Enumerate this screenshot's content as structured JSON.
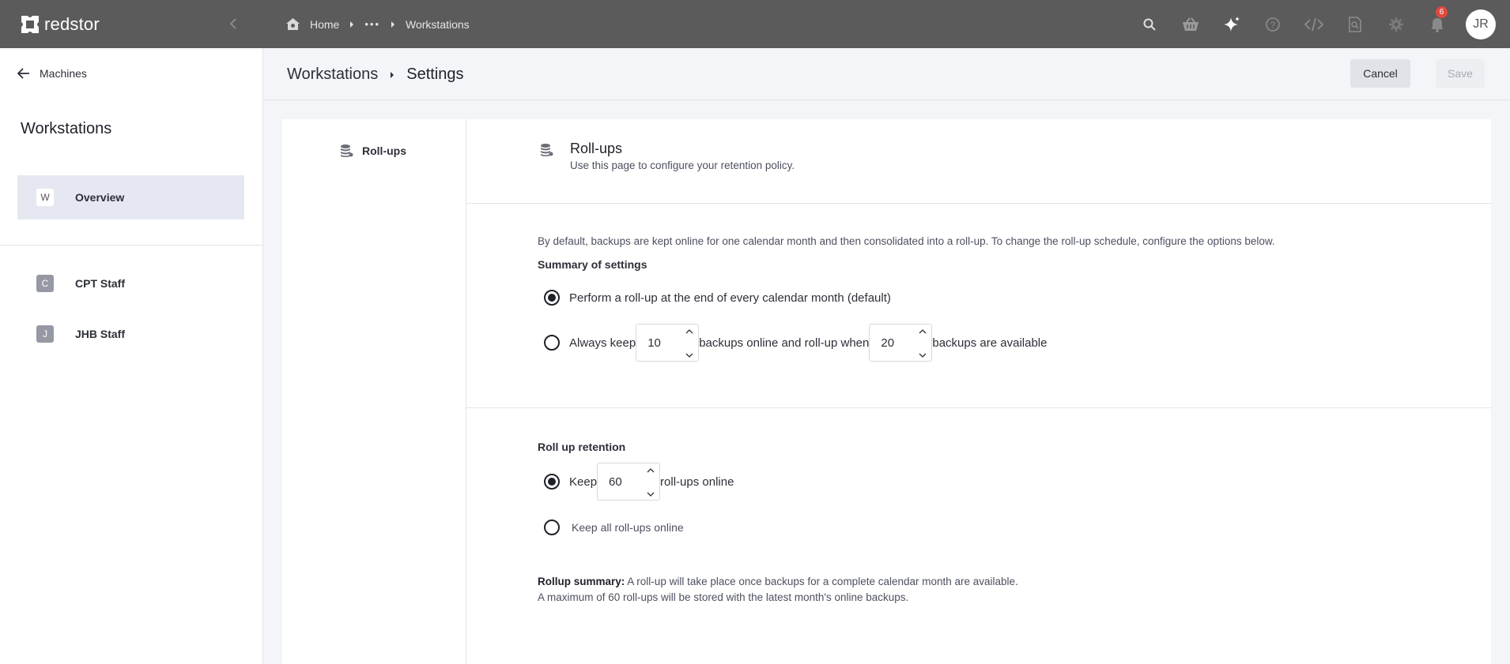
{
  "app": {
    "brand_name": "redstor",
    "accent_color": "#e0493f"
  },
  "topbar": {
    "breadcrumbs": [
      {
        "label": "Home",
        "icon": "home-icon"
      },
      {
        "label": "•••",
        "icon": "ellipsis"
      },
      {
        "label": "Workstations"
      }
    ],
    "icons": [
      "search-icon",
      "basket-icon",
      "sparkle-icon",
      "help-icon",
      "code-icon",
      "file-search-icon",
      "gear-icon",
      "bell-icon"
    ],
    "notification_count": "6",
    "user_initials": "JR"
  },
  "sidebar": {
    "back_label": "Machines",
    "title": "Workstations",
    "items": [
      {
        "letter": "W",
        "label": "Overview",
        "active": true
      },
      {
        "letter": "C",
        "label": "CPT Staff",
        "active": false
      },
      {
        "letter": "J",
        "label": "JHB Staff",
        "active": false
      }
    ]
  },
  "header": {
    "crumb_parent": "Workstations",
    "crumb_current": "Settings",
    "cancel_label": "Cancel",
    "save_label": "Save"
  },
  "settings_nav": {
    "item_label": "Roll-ups"
  },
  "rollups": {
    "title": "Roll-ups",
    "subtitle": "Use this page to configure your retention policy.",
    "description": "By default, backups are kept online for one calendar month and then consolidated into a roll-up. To change the roll-up schedule, configure the options below.",
    "summary_label": "Summary of settings",
    "option_default": "Perform a roll-up at the end of every calendar month (default)",
    "option_custom_prefix": "Always keep",
    "option_custom_keep_value": "10",
    "option_custom_middle": "backups online and roll-up when",
    "option_custom_when_value": "20",
    "option_custom_suffix": "backups are available",
    "selected_option": "default",
    "retention_label": "Roll up retention",
    "retention_keep_prefix": "Keep",
    "retention_keep_value": "60",
    "retention_keep_suffix": "roll-ups online",
    "retention_keep_all": "Keep all roll-ups online",
    "retention_selected": "keep",
    "summary_title": "Rollup summary:",
    "summary_line1": "A roll-up will take place once backups for a complete calendar month are available.",
    "summary_line2": "A maximum of 60 roll-ups will be stored with the latest month's online backups."
  }
}
